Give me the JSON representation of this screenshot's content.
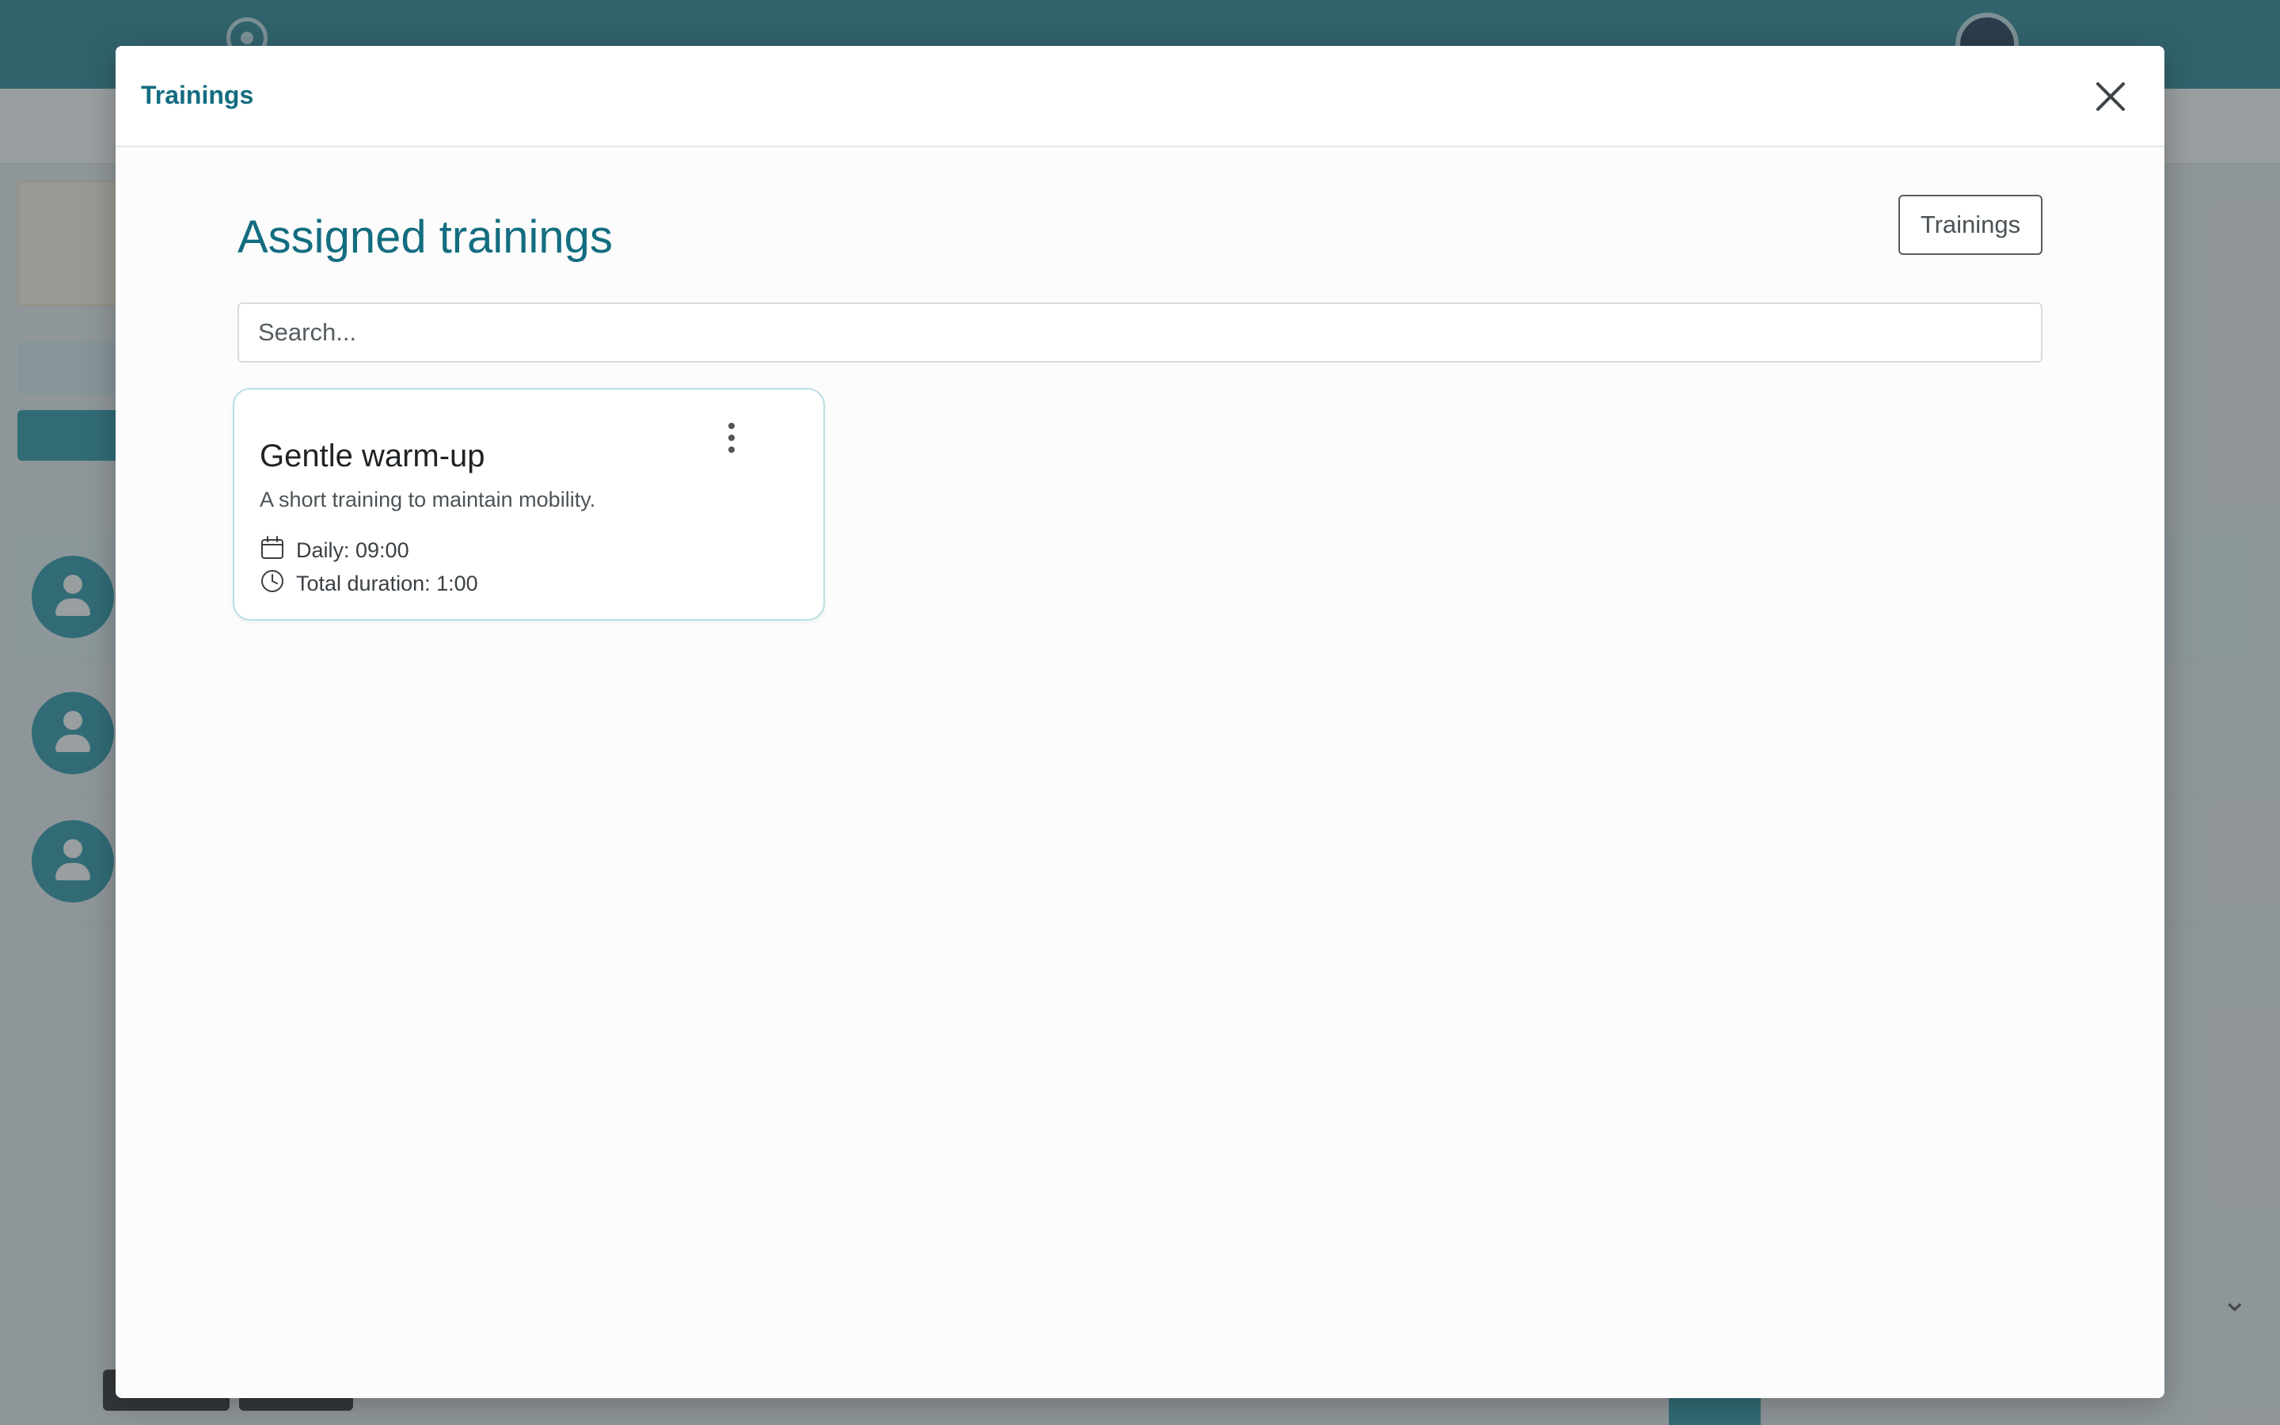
{
  "modal": {
    "title": "Trainings",
    "section_title": "Assigned trainings",
    "trainings_button_label": "Trainings",
    "search": {
      "value": "",
      "placeholder": "Search..."
    }
  },
  "trainings": [
    {
      "title": "Gentle warm-up",
      "description": "A short training to maintain mobility.",
      "schedule": "Daily: 09:00",
      "duration": "Total duration: 1:00"
    }
  ],
  "icons": {
    "close": "close-icon",
    "menu": "more-vertical-icon",
    "schedule": "calendar-icon",
    "duration": "clock-icon"
  },
  "colors": {
    "brand": "#1a7d8e",
    "title_text": "#136d80",
    "card_border": "#b9dfe4"
  }
}
